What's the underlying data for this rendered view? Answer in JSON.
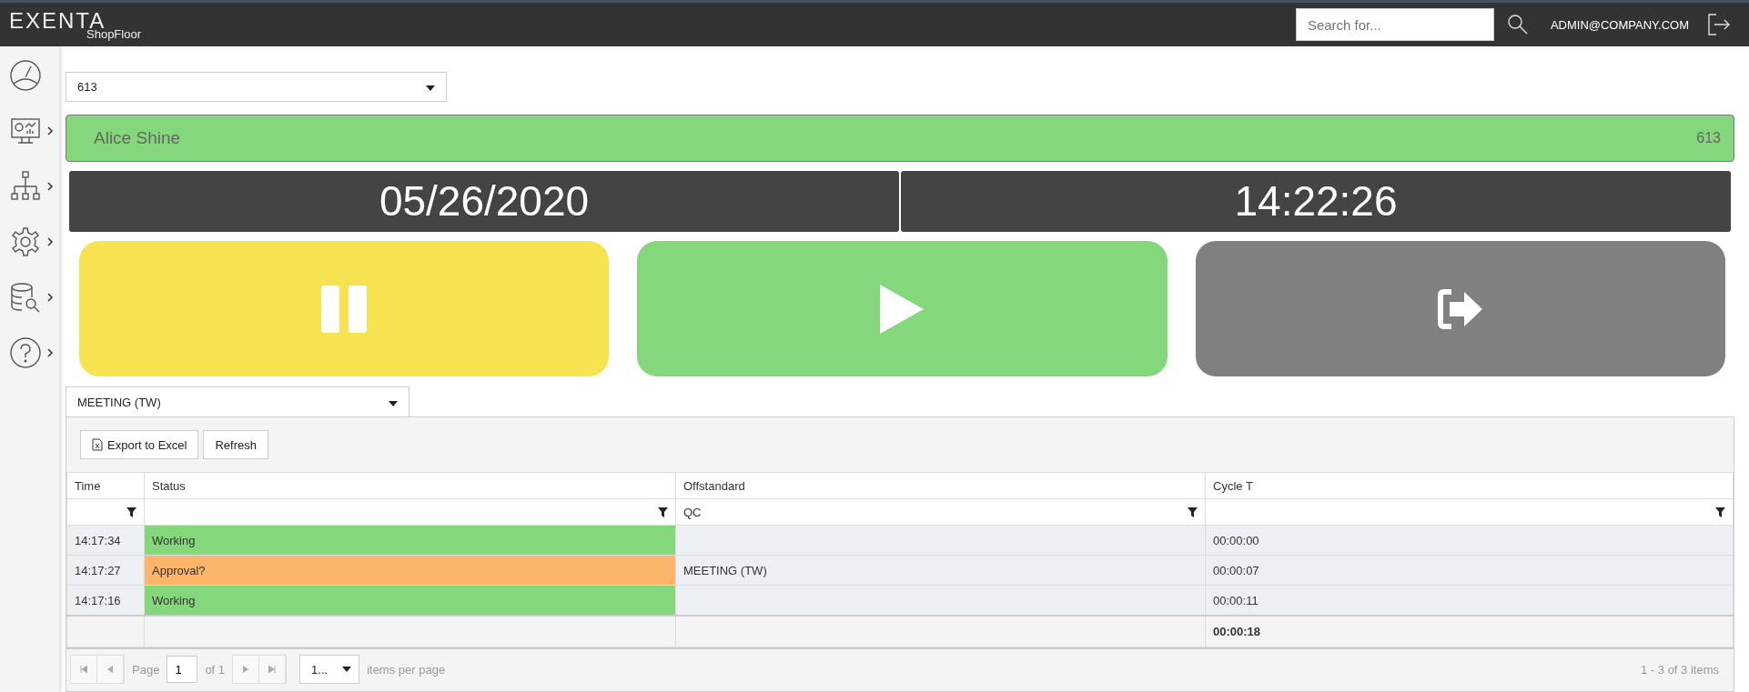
{
  "header": {
    "logo": {
      "title": "EXENTA",
      "subtitle": "ShopFloor"
    },
    "search": {
      "placeholder": "Search for..."
    },
    "user": "ADMIN@COMPANY.COM"
  },
  "sidebar": {
    "items": [
      {
        "kind": "dashboard",
        "expandable": false
      },
      {
        "kind": "monitor",
        "expandable": true
      },
      {
        "kind": "hierarchy",
        "expandable": true
      },
      {
        "kind": "settings",
        "expandable": true
      },
      {
        "kind": "database",
        "expandable": true
      },
      {
        "kind": "help",
        "expandable": true
      }
    ]
  },
  "station_select": {
    "value": "613"
  },
  "operator_bar": {
    "name": "Alice Shine",
    "station": "613",
    "color": "#84d77a"
  },
  "date": "05/26/2020",
  "time": "14:22:26",
  "actions": [
    {
      "kind": "pause",
      "color": "#f7e250"
    },
    {
      "kind": "play",
      "color": "#84d77a"
    },
    {
      "kind": "exit",
      "color": "#808080"
    }
  ],
  "reason_select": {
    "value": "MEETING (TW)"
  },
  "grid": {
    "toolbar": [
      "Export to Excel",
      "Refresh"
    ],
    "columns": [
      "Time",
      "Status",
      "Offstandard",
      "Cycle T"
    ],
    "filters": [
      {
        "filterable": true
      },
      {
        "filterable": true
      },
      {
        "filterable": true,
        "value": "QC"
      },
      {
        "filterable": true
      }
    ],
    "rows": [
      {
        "time": "14:17:34",
        "status": "Working",
        "color": "#84d77a",
        "offstandard": "",
        "cycle": "00:00:00"
      },
      {
        "time": "14:17:27",
        "status": "Approval?",
        "color": "#fdb46b",
        "offstandard": "MEETING (TW)",
        "cycle": "00:00:07"
      },
      {
        "time": "14:17:16",
        "status": "Working",
        "color": "#84d77a",
        "offstandard": "",
        "cycle": "00:00:11"
      }
    ],
    "total": "00:00:18",
    "pager": {
      "page_label": "Page",
      "page": "1",
      "of": "of 1",
      "page_size": "1...",
      "items_label": "items per page",
      "summary": "1 - 3 of 3 items"
    }
  }
}
